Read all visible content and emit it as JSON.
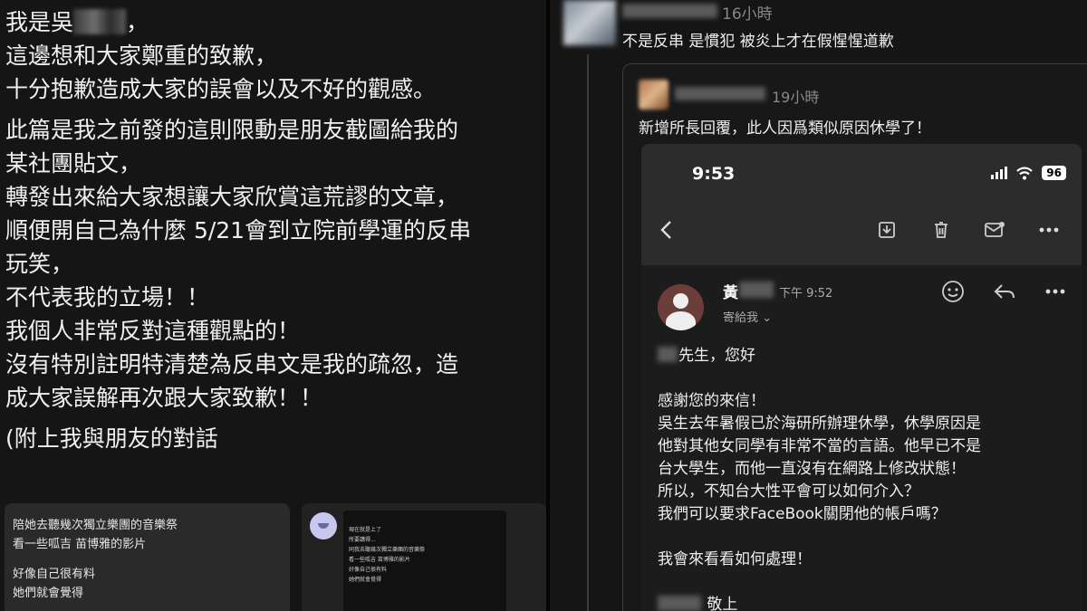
{
  "left_post": {
    "lines": [
      {
        "prefix": "我是吳",
        "suffix": "，"
      },
      "這邊想和大家鄭重的致歉，",
      "十分抱歉造成大家的誤會以及不好的觀感。",
      "此篇是我之前發的這則限動是朋友截圖給我的",
      "某社團貼文，",
      "轉發出來給大家想讓大家欣賞這荒謬的文章，",
      "順便開自己為什麼 5/21會到立院前學運的反串",
      "玩笑，",
      "不代表我的立場！！",
      "我個人非常反對這種觀點的！",
      "沒有特別註明特清楚為反串文是我的疏忽，造",
      "成大家誤解再次跟大家致歉！！",
      "(附上我與朋友的對話"
    ],
    "thumb1_lines": [
      "陪她去聽幾次獨立樂團的音樂祭",
      "看一些呱吉 苗博雅的影片",
      "好像自己很有料",
      "她們就會覺得"
    ],
    "thumb2_lines": [
      "現在就是上了",
      "所要講得...",
      "同我去聽幾次獨立樂團的音樂祭",
      "看一些呱吉 苗博雅的影片",
      "好像自己很有料",
      "她們就會覺得"
    ]
  },
  "comment": {
    "time": "16小時",
    "text": "不是反串 是慣犯 被炎上才在假惺惺道歉"
  },
  "quoted": {
    "time": "19小時",
    "text": "新增所長回覆，此人因爲類似原因休學了！"
  },
  "phone": {
    "status_time": "9:53",
    "battery": "96"
  },
  "email": {
    "sender_initial": "黃",
    "time": "下午 9:52",
    "recipient": "寄給我 ⌄",
    "greeting_suffix": "先生，您好",
    "body_lines": [
      "感謝您的來信！",
      "吳生去年暑假已於海研所辦理休學，休學原因是",
      "他對其他女同學有非常不當的言語。他早已不是",
      "台大學生，而他一直沒有在網路上修改狀態！",
      "所以，不知台大性平會可以如何介入？",
      "我們可以要求FaceBook關閉他的帳戶嗎？",
      "",
      "我會來看看如何處理！",
      ""
    ],
    "signoff": "敬上"
  }
}
